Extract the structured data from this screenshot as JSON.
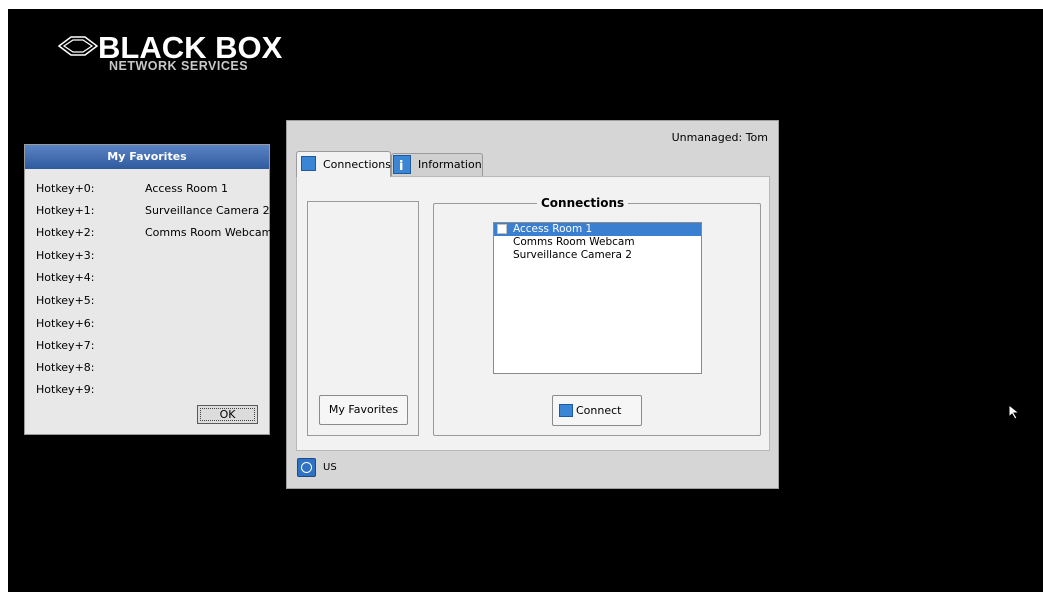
{
  "brand": {
    "name": "BLACK BOX",
    "tagline": "NETWORK SERVICES"
  },
  "favorites_window": {
    "title": "My Favorites",
    "rows": [
      {
        "key": "Hotkey+0:",
        "value": "Access Room 1"
      },
      {
        "key": "Hotkey+1:",
        "value": "Surveillance Camera 2"
      },
      {
        "key": "Hotkey+2:",
        "value": "Comms Room Webcam"
      },
      {
        "key": "Hotkey+3:",
        "value": ""
      },
      {
        "key": "Hotkey+4:",
        "value": ""
      },
      {
        "key": "Hotkey+5:",
        "value": ""
      },
      {
        "key": "Hotkey+6:",
        "value": ""
      },
      {
        "key": "Hotkey+7:",
        "value": ""
      },
      {
        "key": "Hotkey+8:",
        "value": ""
      },
      {
        "key": "Hotkey+9:",
        "value": ""
      }
    ],
    "ok_label": "OK"
  },
  "main_panel": {
    "user_status": "Unmanaged: Tom",
    "tabs": [
      {
        "label": "Connections",
        "icon": "connections-icon",
        "active": true
      },
      {
        "label": "Information",
        "icon": "info-icon",
        "active": false
      }
    ],
    "my_favorites_button": "My Favorites",
    "connections_group": {
      "title": "Connections",
      "items": [
        {
          "label": "Access Room 1",
          "selected": true
        },
        {
          "label": "Comms Room Webcam",
          "selected": false
        },
        {
          "label": "Surveillance Camera 2",
          "selected": false
        }
      ],
      "connect_label": "Connect"
    },
    "keyboard_layout": "US"
  },
  "colors": {
    "background": "#000000",
    "title_bar": "#2f5a9e",
    "selection": "#3a7fd0",
    "panel": "#d6d6d6"
  }
}
